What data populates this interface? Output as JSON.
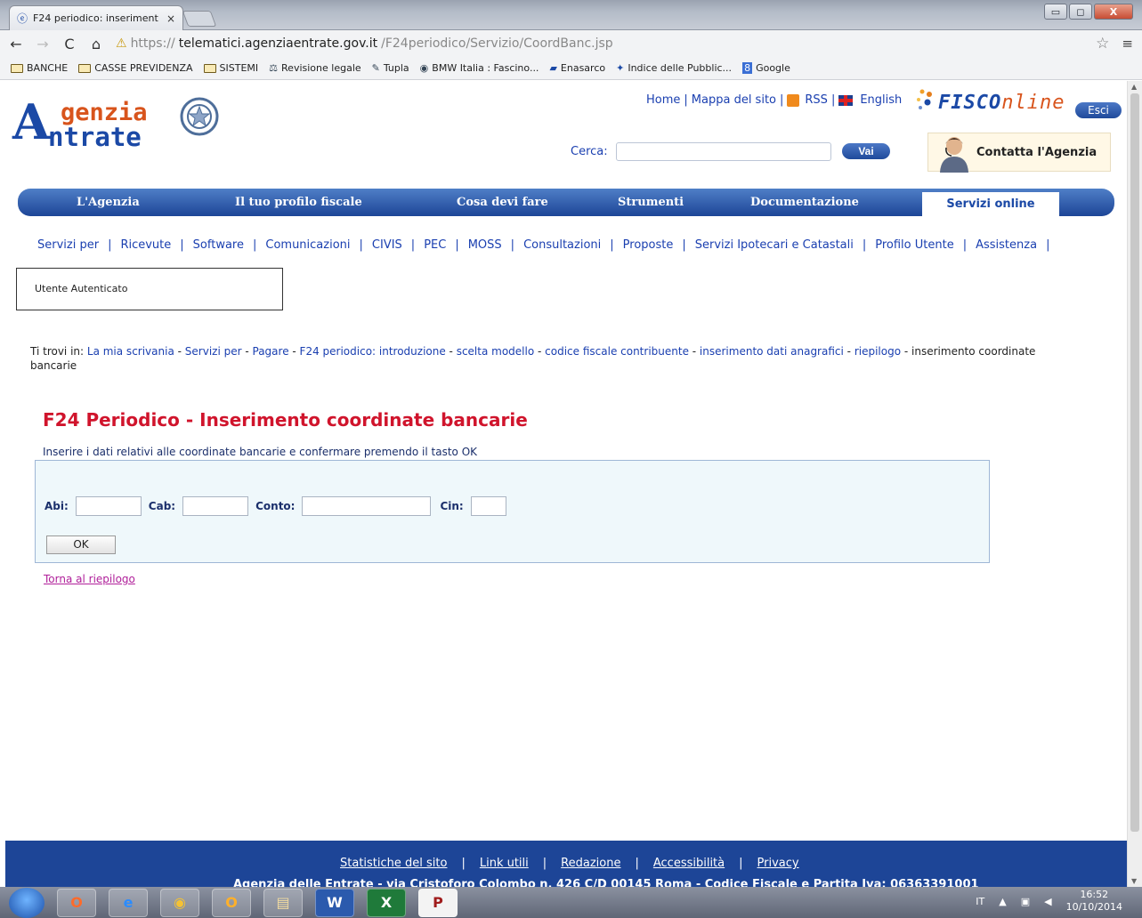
{
  "browser": {
    "tab_title": "F24 periodico: inseriment",
    "tab_close": "×",
    "window": {
      "minimize": "▭",
      "maximize": "◻",
      "close": "X"
    },
    "url_prefix": "https://",
    "url_host": "telematici.agenziaentrate.gov.it",
    "url_path": "/F24periodico/Servizio/CoordBanc.jsp",
    "bookmarks": [
      "BANCHE",
      "CASSE PREVIDENZA",
      "SISTEMI",
      "Revisione legale",
      "Tupla",
      "BMW Italia : Fascino...",
      "Enasarco",
      "Indice delle Pubblic...",
      "Google"
    ]
  },
  "header": {
    "logo_a": "A",
    "logo_line1": "genzia",
    "logo_line2": "ntrate",
    "top_links": [
      "Home",
      "Mappa del sito",
      "RSS",
      "English"
    ],
    "fisco_main": "FISCO",
    "fisco_suffix": "nline",
    "logout": "Esci",
    "search_label": "Cerca:",
    "search_value": "",
    "search_button": "Vai",
    "contact": "Contatta l'Agenzia"
  },
  "main_nav": [
    {
      "label": "L'Agenzia"
    },
    {
      "label": "Il tuo profilo fiscale"
    },
    {
      "label": "Cosa devi fare"
    },
    {
      "label": "Strumenti"
    },
    {
      "label": "Documentazione"
    },
    {
      "label": "Servizi online"
    }
  ],
  "sub_nav": [
    "Servizi per",
    "Ricevute",
    "Software",
    "Comunicazioni",
    "CIVIS",
    "PEC",
    "MOSS",
    "Consultazioni",
    "Proposte",
    "Servizi Ipotecari e Catastali",
    "Profilo Utente",
    "Assistenza"
  ],
  "user_box": "Utente Autenticato",
  "breadcrumb": {
    "prefix": "Ti trovi in:",
    "links": [
      "La mia scrivania",
      "Servizi per",
      "Pagare",
      "F24 periodico: introduzione",
      "scelta modello",
      "codice fiscale contribuente",
      "inserimento dati anagrafici",
      "riepilogo"
    ],
    "current": "inserimento coordinate bancarie"
  },
  "form": {
    "title": "F24 Periodico - Inserimento coordinate bancarie",
    "instruction": "Inserire i dati relativi alle coordinate bancarie e confermare premendo il tasto OK",
    "abi_label": "Abi:",
    "abi_value": "",
    "cab_label": "Cab:",
    "cab_value": "",
    "conto_label": "Conto:",
    "conto_value": "",
    "cin_label": "Cin:",
    "cin_value": "",
    "ok_button": "OK",
    "back_link": "Torna al riepilogo"
  },
  "footer": {
    "links": [
      "Statistiche del sito",
      "Link utili",
      "Redazione",
      "Accessibilità",
      "Privacy"
    ],
    "address": "Agenzia delle Entrate - via Cristoforo Colombo n. 426 C/D 00145 Roma - Codice Fiscale e Partita Iva: 06363391001"
  },
  "taskbar": {
    "apps": [
      "O",
      "e",
      "◉",
      "O",
      "▤",
      "W",
      "X",
      "P"
    ],
    "lang": "IT",
    "time": "16:52",
    "date": "10/10/2014"
  },
  "colors": {
    "brand_blue": "#1d4597",
    "title_red": "#d0142c",
    "orange": "#d8541c"
  }
}
